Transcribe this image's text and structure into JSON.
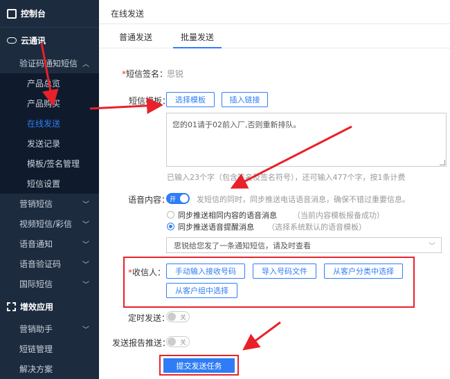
{
  "sidebar": {
    "top": "控制台",
    "section1": "云通讯",
    "group_open": "验证码通知短信",
    "sub_items": [
      "产品总览",
      "产品购买",
      "在线发送",
      "发送记录",
      "模板/签名管理",
      "短信设置"
    ],
    "active_index": 2,
    "menus": [
      "营销短信",
      "视频短信/彩信",
      "语音通知",
      "语音验证码",
      "国际短信"
    ],
    "section2": "增效应用",
    "menus2": [
      "营销助手",
      "短链管理",
      "解决方案"
    ]
  },
  "main": {
    "page_title": "在线发送",
    "tabs": [
      "普通发送",
      "批量发送"
    ],
    "active_tab": 1,
    "signature": {
      "required": "*",
      "label": "短信签名：",
      "value": "思锐"
    },
    "template": {
      "label": "短信模板：",
      "btn_select": "选择模板",
      "btn_link": "插入链接",
      "content": "您的01请于02前入厂,否则重新排队。",
      "hint": "已输入23个字（包含签名及签名符号），还可输入477个字，按1条计费"
    },
    "voice": {
      "label": "语音内容：",
      "toggle": "开",
      "desc": "发短信的同时，同步推送电话语音消息，确保不错过重要信息。",
      "radio1": "同步推送相同内容的语音消息",
      "radio1_note": "（当前内容模板报备成功）",
      "radio2": "同步推送语音提醒消息",
      "radio2_note": "（选择系统默认的语音模板）",
      "select_value": "思锐给您发了一条通知短信，请及时查看"
    },
    "recipients": {
      "required": "*",
      "label": "收信人：",
      "btn_manual": "手动输入接收号码",
      "btn_import": "导入号码文件",
      "btn_category": "从客户分类中选择",
      "btn_group": "从客户组中选择"
    },
    "schedule": {
      "label": "定时发送：",
      "toggle": "关"
    },
    "report": {
      "label": "发送报告推送：",
      "toggle": "关"
    },
    "submit": "提交发送任务"
  },
  "colors": {
    "sidebar_bg": "#1c2b3e",
    "accent": "#2f7df6",
    "highlight": "#e8212a"
  }
}
